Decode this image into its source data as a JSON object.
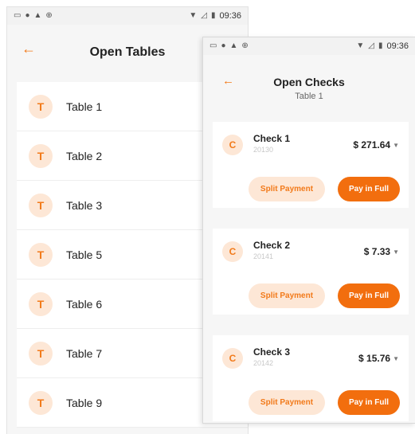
{
  "theme": {
    "accent": "#f27a1a",
    "accent_light": "#fde7d6",
    "pay_button": "#f26e0e"
  },
  "status_bar": {
    "time": "09:36",
    "left_icons": [
      "sim-card-icon",
      "circle-icon",
      "warning-icon",
      "vpn-icon"
    ],
    "right_icons": [
      "wifi-icon",
      "no-signal-icon",
      "battery-icon"
    ]
  },
  "tables_screen": {
    "title": "Open Tables",
    "tables": [
      {
        "avatar": "T",
        "label": "Table 1"
      },
      {
        "avatar": "T",
        "label": "Table 2"
      },
      {
        "avatar": "T",
        "label": "Table 3"
      },
      {
        "avatar": "T",
        "label": "Table 5"
      },
      {
        "avatar": "T",
        "label": "Table 6"
      },
      {
        "avatar": "T",
        "label": "Table 7"
      },
      {
        "avatar": "T",
        "label": "Table 9"
      }
    ]
  },
  "checks_screen": {
    "title": "Open Checks",
    "subtitle": "Table 1",
    "split_label": "Split Payment",
    "pay_label": "Pay in Full",
    "checks": [
      {
        "avatar": "C",
        "name": "Check 1",
        "number": "20130",
        "amount": "$ 271.64"
      },
      {
        "avatar": "C",
        "name": "Check 2",
        "number": "20141",
        "amount": "$ 7.33"
      },
      {
        "avatar": "C",
        "name": "Check 3",
        "number": "20142",
        "amount": "$ 15.76"
      }
    ]
  }
}
